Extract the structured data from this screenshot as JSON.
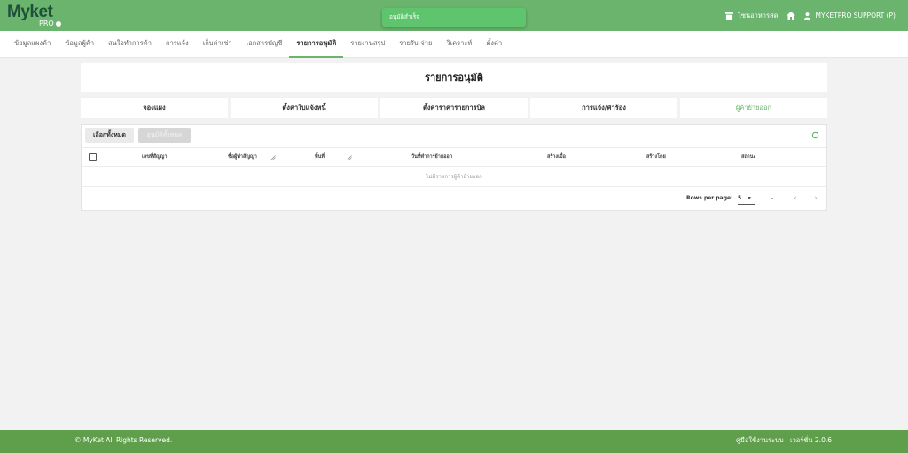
{
  "app": {
    "logo_text": "Myket",
    "logo_sub": "PRO"
  },
  "toast": {
    "message": "อนุมัติสำเร็จ"
  },
  "header": {
    "store_link": "โซนอาหารสด",
    "user_name": "MYKETPRO SUPPORT (P)"
  },
  "nav": {
    "items": [
      {
        "label": "ข้อมูลแผงค้า"
      },
      {
        "label": "ข้อมูลผู้ค้า"
      },
      {
        "label": "สนใจทำการค้า"
      },
      {
        "label": "การแจ้ง"
      },
      {
        "label": "เก็บค่าเช่า"
      },
      {
        "label": "เอกสารบัญชี"
      },
      {
        "label": "รายการอนุมัติ"
      },
      {
        "label": "รายงานสรุป"
      },
      {
        "label": "รายรับ-จ่าย"
      },
      {
        "label": "วิเคราะห์"
      },
      {
        "label": "ตั้งค่า"
      }
    ],
    "active_index": 6
  },
  "page": {
    "title": "รายการอนุมัติ"
  },
  "tabs": [
    {
      "label": "จองแผง"
    },
    {
      "label": "ตั้งค่าใบแจ้งหนี้"
    },
    {
      "label": "ตั้งค่าราคารายการบิล"
    },
    {
      "label": "การแจ้ง/คำร้อง"
    },
    {
      "label": "ผู้ค้าย้ายออก"
    }
  ],
  "active_tab_index": 4,
  "toolbar": {
    "select_all_label": "เลือกทั้งหมด",
    "approve_all_label": "อนุมัติทั้งหมด"
  },
  "table": {
    "columns": [
      {
        "label": "เลขที่สัญญา"
      },
      {
        "label": "ชื่อผู้ทำสัญญา"
      },
      {
        "label": "พื้นที่"
      },
      {
        "label": "วันที่ทำการย้ายออก"
      },
      {
        "label": "สร้างเมื่อ"
      },
      {
        "label": "สร้างโดย"
      },
      {
        "label": "สถานะ"
      }
    ],
    "empty_message": "ไม่มีรายการผู้ค้าย้ายออก"
  },
  "pagination": {
    "rows_per_page_label": "Rows per page:",
    "rows_per_page_value": "5",
    "range_text": "–"
  },
  "footer": {
    "copyright": "© MyKet All Rights Reserved.",
    "manual_link": "คู่มือใช้งานระบบ",
    "separator": "|",
    "version": "เวอร์ชั่น 2.0.6"
  },
  "colors": {
    "brand_green": "#6ab46e",
    "footer_green": "#5f9e4a",
    "toast_green": "#5ec46e"
  }
}
